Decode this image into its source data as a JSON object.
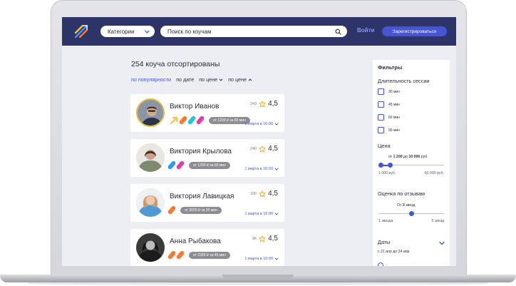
{
  "header": {
    "category_label": "Категории",
    "search_placeholder": "Поиск по коучам",
    "login_label": "Войти",
    "signup_label": "Зарегистрироваться"
  },
  "results": {
    "title": "254 коуча отсортированы",
    "sort_options": [
      {
        "label": "по популярности",
        "active": true
      },
      {
        "label": "по дате",
        "active": false
      },
      {
        "label": "по цене",
        "icon": "chevron-down-icon",
        "active": false
      },
      {
        "label": "по цене",
        "icon": "chevron-up-icon",
        "active": false
      }
    ]
  },
  "coaches": [
    {
      "name": "Виктор Иванов",
      "reviews": "243",
      "rating": "4,5",
      "price": "от 1200 ₽ за 60 мин",
      "slot": "1 марта в 10:00",
      "tags": [
        "#f5c43c",
        "#ff7a2e",
        "#21c6e0",
        "#e43ca8"
      ]
    },
    {
      "name": "Виктория Крылова",
      "reviews": "240",
      "rating": "4,5",
      "price": "от 1200 ₽ за 60 мин",
      "slot": "1 марта в 10:00",
      "tags": [
        "#2e9cf0",
        "#e43ca8"
      ]
    },
    {
      "name": "Виктория Лавицкая",
      "reviews": "100",
      "rating": "4,5",
      "price": "от 3000 ₽ за 30 мин",
      "slot": "1 марта в 10:00",
      "tags": [
        "#ff7a2e"
      ]
    },
    {
      "name": "Анна Рыбакова",
      "reviews": "96",
      "rating": "4,5",
      "price": "от 2399 ₽ за 45 мин",
      "slot": "1 марта в 10:00",
      "tags": [
        "#ff7a2e",
        "#ff7a2e"
      ]
    }
  ],
  "filters": {
    "title": "Фильтры",
    "duration_title": "Длительность сессии",
    "durations": [
      "30 мин",
      "45 мин",
      "60 мин",
      "90 мин"
    ],
    "price_title": "Цена",
    "price_range_prefix": "от",
    "price_from": "1 200",
    "price_range_mid": "до",
    "price_to": "10 000",
    "price_range_suffix": "руб.",
    "price_min_label": "1 000 руб.",
    "price_max_label": "60 000 руб.",
    "price_low_fraction": 0.0,
    "price_high_fraction": 0.15,
    "reviews_title": "Оценка по отзывам",
    "reviews_range_prefix": "От",
    "reviews_from": "3",
    "reviews_range_suffix": "звезд",
    "reviews_min_label": "1 звезда",
    "reviews_max_label": "5 звезд",
    "reviews_value": 3,
    "dates_title": "Даты",
    "dates_range": "с 21 апр до 24 апр"
  },
  "colors": {
    "brand_dark": "#2d3568",
    "accent": "#4656d3",
    "star": "#f3a619"
  }
}
